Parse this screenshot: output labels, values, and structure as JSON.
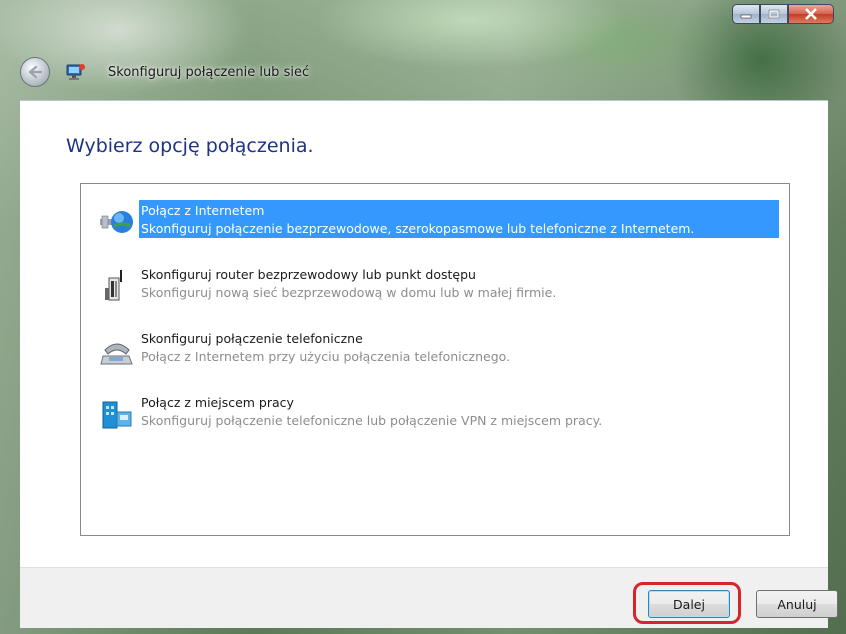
{
  "window": {
    "title": "Skonfiguruj połączenie lub sieć",
    "controls": [
      "minimize-icon",
      "maximize-icon",
      "close-icon"
    ],
    "close_color": "#c43c26"
  },
  "main": {
    "heading": "Wybierz opcję połączenia.",
    "options": [
      {
        "title": "Połącz z Internetem",
        "description": "Skonfiguruj połączenie bezprzewodowe, szerokopasmowe lub telefoniczne z Internetem.",
        "icon": "globe-network-icon",
        "selected": true
      },
      {
        "title": "Skonfiguruj router bezprzewodowy lub punkt dostępu",
        "description": "Skonfiguruj nową sieć bezprzewodową w domu lub w małej firmie.",
        "icon": "wireless-router-icon",
        "selected": false
      },
      {
        "title": "Skonfiguruj połączenie telefoniczne",
        "description": "Połącz z Internetem przy użyciu połączenia telefonicznego.",
        "icon": "phone-modem-icon",
        "selected": false
      },
      {
        "title": "Połącz z miejscem pracy",
        "description": "Skonfiguruj połączenie telefoniczne lub połączenie VPN z miejscem pracy.",
        "icon": "workplace-building-icon",
        "selected": false
      }
    ],
    "selection_color": "#3399ff"
  },
  "footer": {
    "next_label": "Dalej",
    "cancel_label": "Anuluj",
    "highlight_color": "#d6262b"
  }
}
